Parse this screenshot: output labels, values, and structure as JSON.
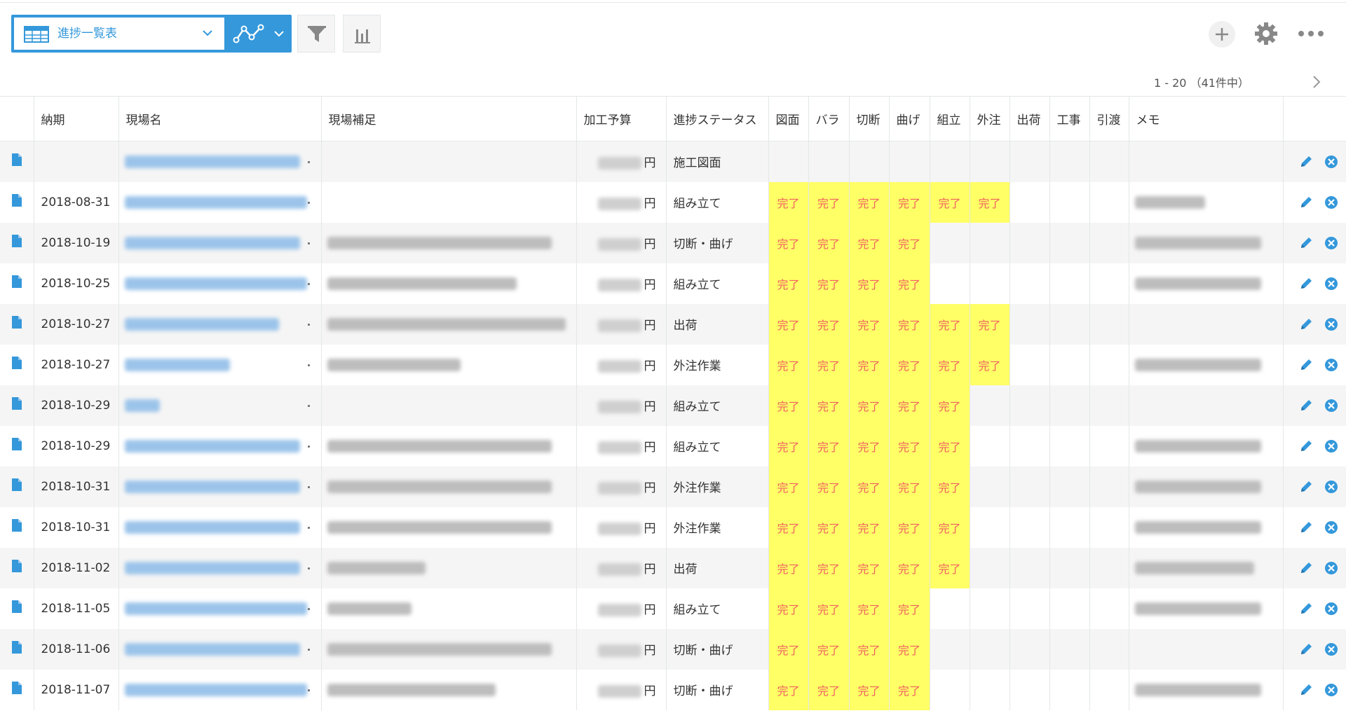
{
  "toolbar": {
    "view_name": "進捗一覧表",
    "icons": [
      "table-icon",
      "chevron-down-icon",
      "graph-icon",
      "chevron-down-icon",
      "filter-icon",
      "bar-chart-icon",
      "plus-icon",
      "gear-icon",
      "more-icon"
    ],
    "accent_color": "#3498db"
  },
  "pager": {
    "range": "1 - 20 （41件中）"
  },
  "columns": {
    "deadline": "納期",
    "site_name": "現場名",
    "site_supplement": "現場補足",
    "budget": "加工予算",
    "status": "進捗ステータス",
    "zumen": "図面",
    "bara": "バラ",
    "setsudan": "切断",
    "mage": "曲げ",
    "kumitate": "組立",
    "gaichu": "外注",
    "shukka": "出荷",
    "koji": "工事",
    "hikiwatashi": "引渡",
    "memo": "メモ"
  },
  "rows": [
    {
      "deadline": "",
      "status": "施工図面",
      "yen": "円"
    },
    {
      "deadline": "2018-08-31",
      "status": "組み立て",
      "yen": "円"
    },
    {
      "deadline": "2018-10-19",
      "status": "切断・曲げ",
      "yen": "円"
    },
    {
      "deadline": "2018-10-25",
      "status": "組み立て",
      "yen": "円"
    },
    {
      "deadline": "2018-10-27",
      "status": "出荷",
      "yen": "円"
    },
    {
      "deadline": "2018-10-27",
      "status": "外注作業",
      "yen": "円"
    },
    {
      "deadline": "2018-10-29",
      "status": "組み立て",
      "yen": "円"
    },
    {
      "deadline": "2018-10-29",
      "status": "組み立て",
      "yen": "円"
    },
    {
      "deadline": "2018-10-31",
      "status": "外注作業",
      "yen": "円"
    },
    {
      "deadline": "2018-10-31",
      "status": "外注作業",
      "yen": "円"
    },
    {
      "deadline": "2018-11-02",
      "status": "出荷",
      "yen": "円"
    },
    {
      "deadline": "2018-11-05",
      "status": "組み立て",
      "yen": "円"
    },
    {
      "deadline": "2018-11-06",
      "status": "切断・曲げ",
      "yen": "円"
    },
    {
      "deadline": "2018-11-07",
      "status": "切断・曲げ",
      "yen": "円"
    }
  ],
  "done_counts": [
    0,
    6,
    4,
    4,
    6,
    6,
    5,
    5,
    5,
    5,
    5,
    4,
    4,
    4
  ],
  "done_label": "完了",
  "colors": {
    "done_bg": "#ffff66",
    "done_text": "#f06060",
    "link": "#3498db"
  }
}
